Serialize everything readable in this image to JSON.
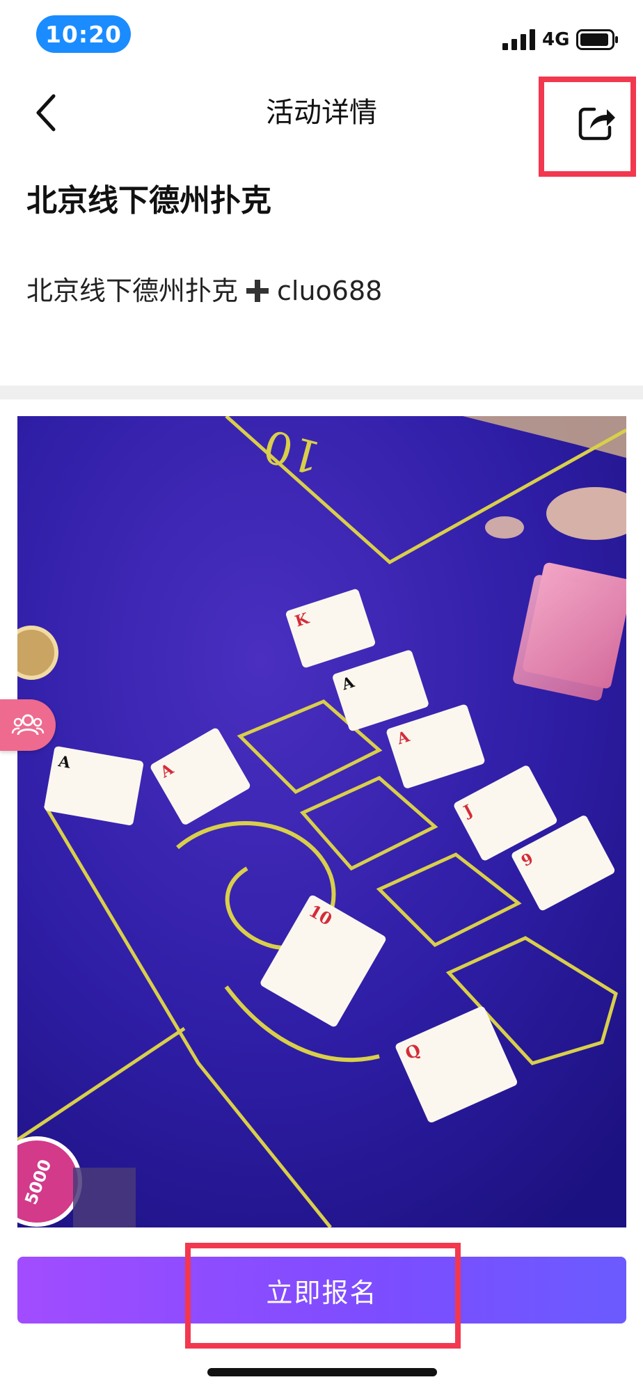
{
  "status_bar": {
    "time": "10:20",
    "network": "4G"
  },
  "nav": {
    "title": "活动详情",
    "back_icon": "chevron-left-icon",
    "share_icon": "share-icon"
  },
  "event": {
    "title": "北京线下德州扑克",
    "description_prefix": "北京线下德州扑克",
    "description_suffix": "cluo688"
  },
  "photo": {
    "cards": [
      "K",
      "A",
      "A",
      "A",
      "A",
      "J",
      "9",
      "10",
      "Q"
    ],
    "chip_value": "5000"
  },
  "actions": {
    "signup_label": "立即报名"
  },
  "colors": {
    "accent": "#7c4dff",
    "status_pill": "#1a8cff",
    "highlight": "#f2384f",
    "float_button": "#ee6a8e"
  }
}
